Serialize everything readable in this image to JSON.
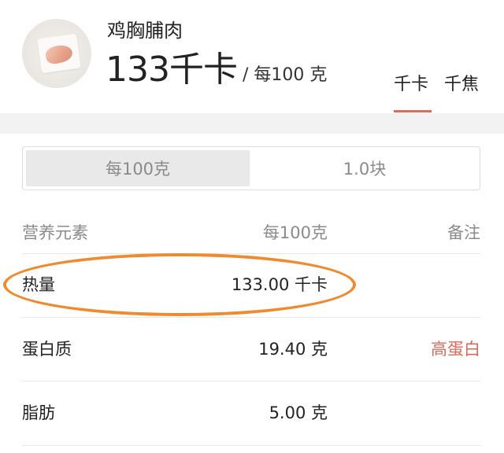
{
  "food": {
    "name": "鸡胸脯肉",
    "calories": "133千卡",
    "per_unit": "/ 每100 克"
  },
  "unit_tabs": [
    {
      "label": "千卡",
      "active": true
    },
    {
      "label": "千焦",
      "active": false
    }
  ],
  "portion_toggle": {
    "left": "每100克",
    "right": "1.0块",
    "selected": "left"
  },
  "table": {
    "headers": {
      "name": "营养元素",
      "per": "每100克",
      "note": "备注"
    },
    "rows": [
      {
        "name": "热量",
        "value": "133.00 千卡",
        "note": ""
      },
      {
        "name": "蛋白质",
        "value": "19.40 克",
        "note": "高蛋白"
      },
      {
        "name": "脂肪",
        "value": "5.00 克",
        "note": ""
      }
    ]
  },
  "colors": {
    "accent": "#e26a5a",
    "note_text": "#d96a5b",
    "highlight_ring": "#f08a2e"
  }
}
